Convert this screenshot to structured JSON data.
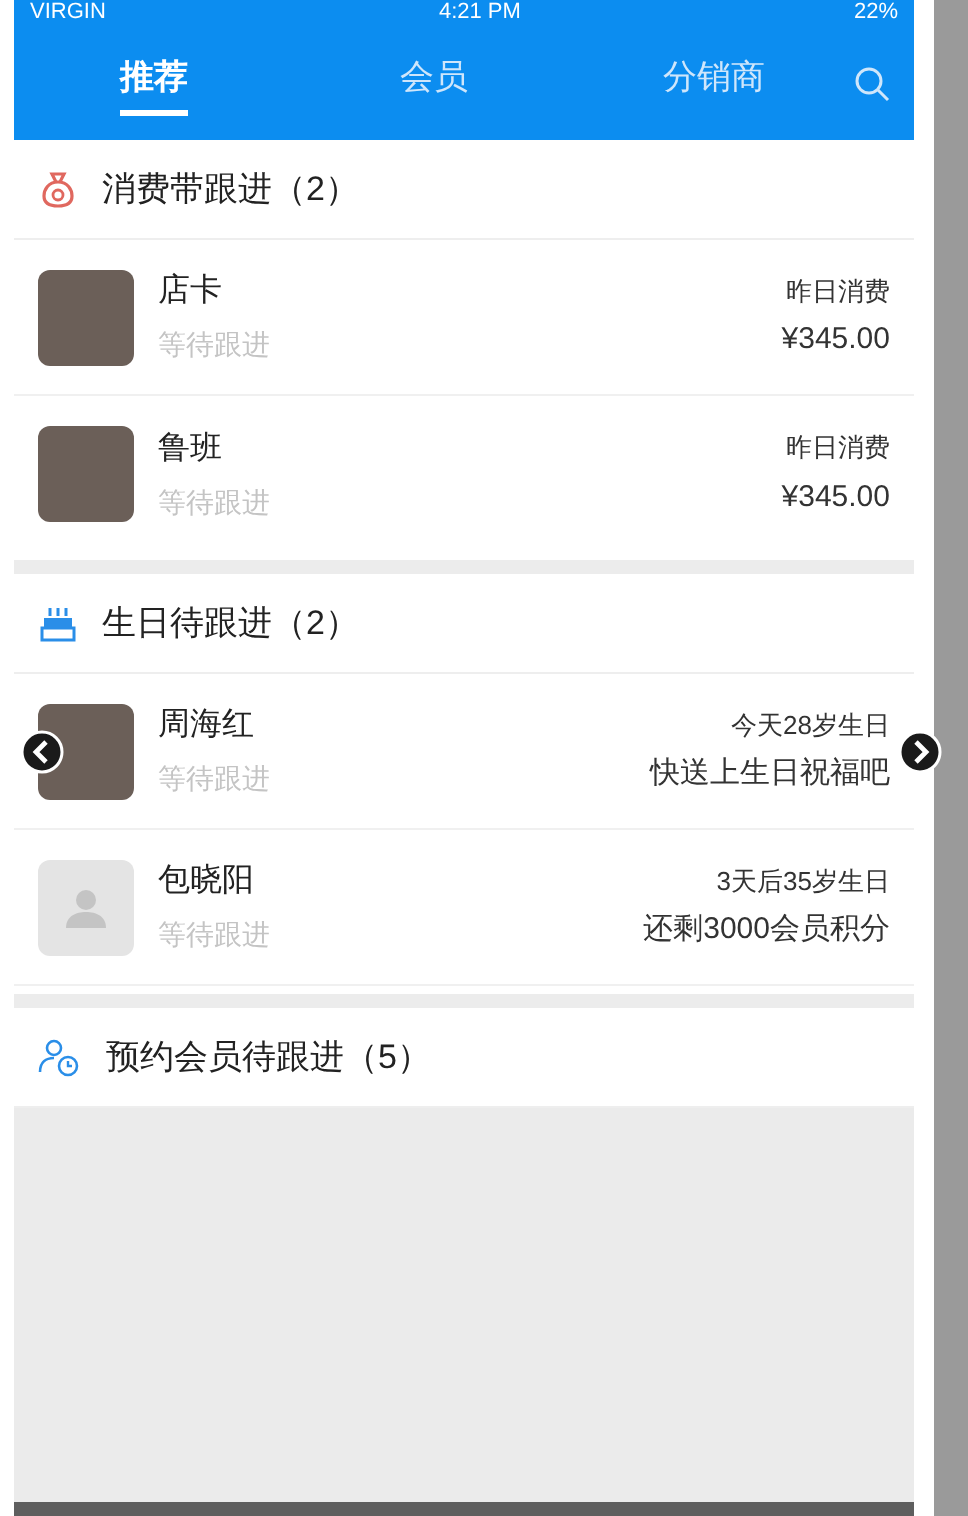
{
  "status_bar": {
    "carrier": "VIRGIN",
    "time": "4:21 PM",
    "battery": "22%"
  },
  "tabs": [
    {
      "label": "推荐",
      "selected": true
    },
    {
      "label": "会员",
      "selected": false
    },
    {
      "label": "分销商",
      "selected": false
    }
  ],
  "sections": [
    {
      "kind": "spending",
      "title": "消费带跟进（2）",
      "rows": [
        {
          "name": "店卡",
          "status": "等待跟进",
          "note": "昨日消费",
          "detail": "¥345.00",
          "kind": "photo"
        },
        {
          "name": "鲁班",
          "status": "等待跟进",
          "note": "昨日消费",
          "detail": "¥345.00",
          "kind": "photo"
        }
      ]
    },
    {
      "kind": "birthday",
      "title": "生日待跟进（2）",
      "rows": [
        {
          "name": "周海红",
          "status": "等待跟进",
          "note": "今天28岁生日",
          "detail": "快送上生日祝福吧",
          "kind": "photo"
        },
        {
          "name": "包晓阳",
          "status": "等待跟进",
          "note": "3天后35岁生日",
          "detail": "还剩3000会员积分",
          "kind": "placeholder"
        }
      ]
    },
    {
      "kind": "booking",
      "title": "预约会员待跟进（5）"
    }
  ]
}
